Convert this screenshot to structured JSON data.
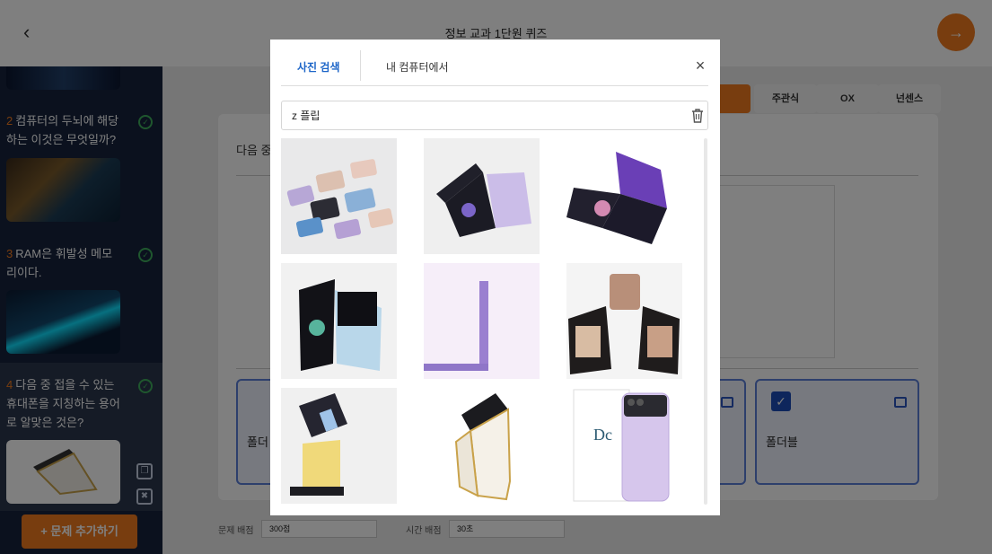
{
  "header": {
    "title": "정보 교과 1단원 퀴즈",
    "back_icon": "chevron-left-icon",
    "next_icon": "arrow-right-icon",
    "accent": "#f07a1f"
  },
  "sidebar": {
    "questions": [
      {
        "num": "2",
        "text": "컴퓨터의 두뇌에 해당하는 이것은 무엇일까?"
      },
      {
        "num": "3",
        "text": "RAM은 휘발성 메모리이다."
      },
      {
        "num": "4",
        "text": "다음 중 접을 수 있는 휴대폰을 지칭하는 용어로 알맞은 것은?"
      }
    ],
    "add_button": "+  문제 추가하기"
  },
  "editor": {
    "types": [
      "주관식",
      "OX",
      "넌센스"
    ],
    "prompt": "다음 중",
    "answers": [
      {
        "text": "폴더"
      },
      {
        "text": "폴더블"
      }
    ],
    "score_label": "문제 배점",
    "score_value": "300점",
    "time_label": "시간 배점",
    "time_value": "30초"
  },
  "modal": {
    "tabs": [
      "사진 검색",
      "내 컴퓨터에서"
    ],
    "search": {
      "value": "z 플립"
    },
    "results": [
      {
        "name": "result-flip-color-grid"
      },
      {
        "name": "result-flip-lavender-open"
      },
      {
        "name": "result-flip-purple-flower"
      },
      {
        "name": "result-flip-black-blue"
      },
      {
        "name": "result-flip-purple-side"
      },
      {
        "name": "result-flip-bronze-pair"
      },
      {
        "name": "result-flip-yellow-stand"
      },
      {
        "name": "result-flip-white-gold"
      },
      {
        "name": "result-flip-case-box"
      }
    ]
  }
}
